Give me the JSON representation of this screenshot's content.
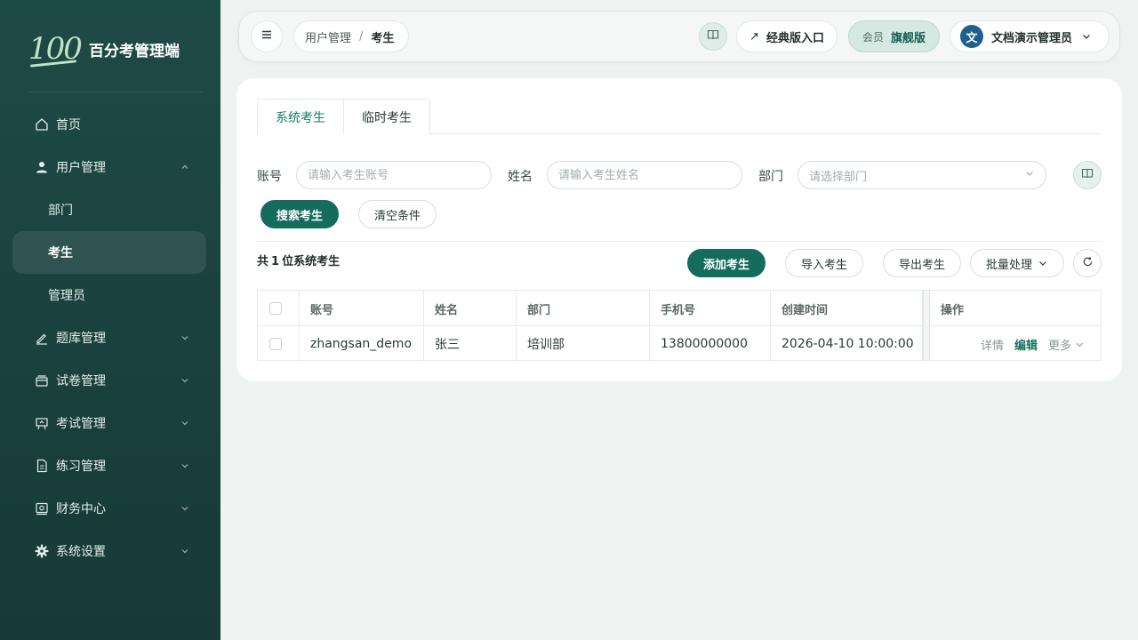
{
  "brand": {
    "logo_text": "100",
    "name": "百分考管理端"
  },
  "sidebar": {
    "items": [
      {
        "label": "首页"
      },
      {
        "label": "用户管理"
      },
      {
        "label": "题库管理"
      },
      {
        "label": "试卷管理"
      },
      {
        "label": "考试管理"
      },
      {
        "label": "练习管理"
      },
      {
        "label": "财务中心"
      },
      {
        "label": "系统设置"
      }
    ],
    "user_submenu": [
      {
        "label": "部门"
      },
      {
        "label": "考生",
        "active": true
      },
      {
        "label": "管理员"
      }
    ]
  },
  "header": {
    "breadcrumb": {
      "parent": "用户管理",
      "separator": "/",
      "current": "考生"
    },
    "classic_label": "经典版入口",
    "classic_arrow": "↗",
    "member_label": "会员",
    "member_value": "旗舰版",
    "user": {
      "avatar": "文",
      "name": "文档演示管理员"
    }
  },
  "tabs": [
    {
      "label": "系统考生",
      "active": true
    },
    {
      "label": "临时考生",
      "active": false
    }
  ],
  "filters": {
    "account_label": "账号",
    "account_placeholder": "请输入考生账号",
    "name_label": "姓名",
    "name_placeholder": "请输入考生姓名",
    "dept_label": "部门",
    "dept_placeholder": "请选择部门",
    "search_button": "搜索考生",
    "clear_button": "清空条件"
  },
  "toolbar": {
    "total_prefix": "共",
    "total_count": "1",
    "total_suffix": "位系统考生",
    "add_button": "添加考生",
    "import_button": "导入考生",
    "export_button": "导出考生",
    "batch_button": "批量处理"
  },
  "table": {
    "columns": [
      "账号",
      "姓名",
      "部门",
      "手机号",
      "创建时间",
      "操作"
    ],
    "rows": [
      {
        "account": "zhangsan_demo",
        "name": "张三",
        "dept": "培训部",
        "phone": "13800000000",
        "created": "2026-04-10 10:00:00",
        "op_detail": "详情",
        "op_edit": "编辑",
        "op_more": "更多"
      }
    ]
  },
  "colors": {
    "sidebar_bg": "#1e4a45",
    "primary": "#146c5d",
    "accent_text": "#1a7a68",
    "page_bg": "#eef2f1"
  },
  "icons": {
    "home": "home-icon",
    "user": "user-icon",
    "question_bank": "pen-icon",
    "paper": "briefcase-icon",
    "exam": "presentation-icon",
    "practice": "document-icon",
    "finance": "finance-icon",
    "settings": "gear-icon",
    "menu": "hamburger-icon",
    "doc": "book-icon",
    "refresh": "refresh-icon"
  }
}
